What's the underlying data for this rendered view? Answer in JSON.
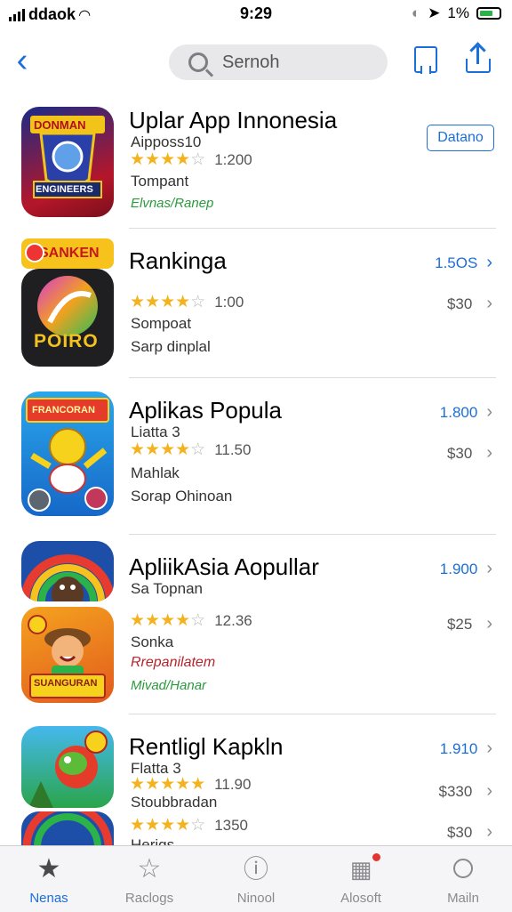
{
  "status_bar": {
    "carrier": "ddaok",
    "time": "9:29",
    "battery": "1%"
  },
  "nav": {
    "search_placeholder": "Sernoh"
  },
  "apps": [
    {
      "name": "Uplar App Innonesia",
      "line1": "Aipposs10",
      "rating_count": "1:200",
      "line2": "Tompant",
      "line3": "Elvnas/Ranep",
      "action": "Datano",
      "stars": 4
    },
    {
      "name": "Rankinga",
      "link": "1.5OS",
      "rating_count": "1:00",
      "line2": "Sompoat",
      "line3": "Sarp dinplal",
      "price": "$30",
      "stars": 4
    },
    {
      "name": "Aplikas Popula",
      "line1": "Liatta 3",
      "link": "1.800",
      "rating_count": "11.50",
      "line2": "Mahlak",
      "line3": "Sorap Ohinoan",
      "price": "$30",
      "stars": 4
    },
    {
      "name": "ApliikAsia Aopullar",
      "line1": "Sa Topnan",
      "link": "1.900",
      "rating_count": "12.36",
      "line2": "Sonka",
      "line3": "Rrepanilatem",
      "line4": "Mivad/Hanar",
      "price": "$25",
      "stars": 4
    },
    {
      "name": "Rentligl Kapkln",
      "line1": "Flatta 3",
      "link": "1.910",
      "rating_count": "11.90",
      "line2": "Stoubbradan",
      "price": "$330",
      "stars": 5,
      "rating_count2": "1350",
      "price2": "$30",
      "line3": "Herigs"
    }
  ],
  "icon_texts": {
    "app1_top": "DONMAN",
    "app1_bottom": "ENGINEERS",
    "app2_banner": "SANKEN",
    "app2_word": "POIRO",
    "app3_banner": "FRANCORAN",
    "app4_banner": "SUANGURAN"
  },
  "tabs": [
    {
      "label": "Nenas",
      "icon": "star-filled-icon"
    },
    {
      "label": "Raclogs",
      "icon": "star-outline-icon"
    },
    {
      "label": "Ninool",
      "icon": "clock-icon"
    },
    {
      "label": "Alosoft",
      "icon": "calendar-badge-icon"
    },
    {
      "label": "Mailn",
      "icon": "search-icon"
    }
  ],
  "colors": {
    "accent": "#1a6fd8",
    "star": "#f4b21f",
    "green_text": "#2a9a3e",
    "red_text": "#b8242c"
  }
}
